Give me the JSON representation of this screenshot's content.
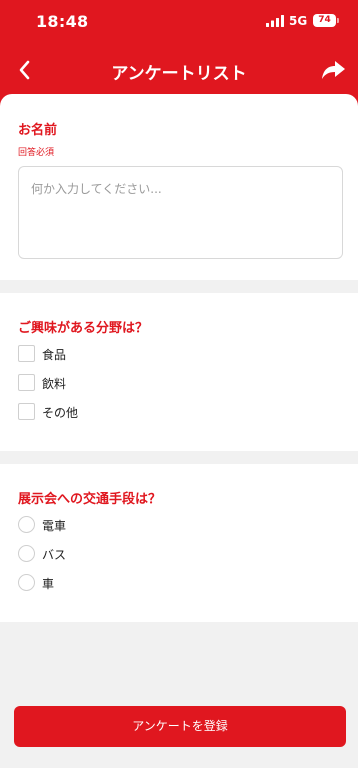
{
  "status_bar": {
    "time": "18:48",
    "network": "5G",
    "battery": "74"
  },
  "nav": {
    "title": "アンケートリスト",
    "back_icon": "chevron-left-icon",
    "share_icon": "share-icon"
  },
  "questions": {
    "name": {
      "title": "お名前",
      "required": "回答必須",
      "placeholder": "何か入力してください..."
    },
    "interest": {
      "title": "ご興味がある分野は？",
      "options": [
        "食品",
        "飲料",
        "その他"
      ]
    },
    "transport": {
      "title": "展示会への交通手段は？",
      "options": [
        "電車",
        "バス",
        "車"
      ]
    }
  },
  "submit_label": "アンケートを登録",
  "colors": {
    "accent": "#e0171f",
    "background": "#f1f1f1"
  }
}
